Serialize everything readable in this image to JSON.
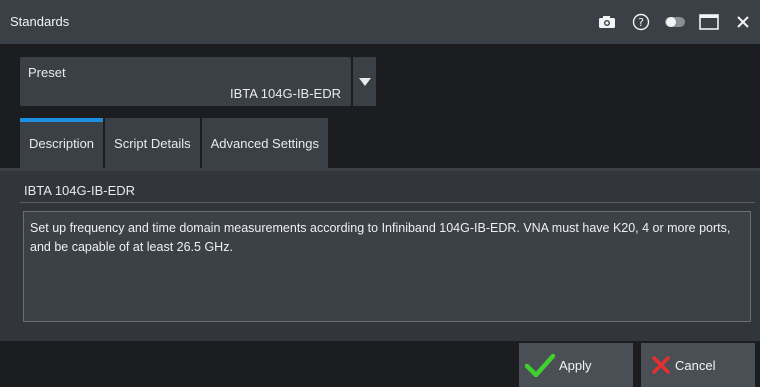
{
  "window": {
    "title": "Standards",
    "icons": [
      "camera-icon",
      "help-icon",
      "toggle-icon",
      "maximize-icon",
      "close-icon"
    ]
  },
  "preset": {
    "label": "Preset",
    "value": "IBTA 104G-IB-EDR"
  },
  "tabs": [
    {
      "label": "Description",
      "active": true
    },
    {
      "label": "Script Details",
      "active": false
    },
    {
      "label": "Advanced Settings",
      "active": false
    }
  ],
  "description": {
    "heading": "IBTA 104G-IB-EDR",
    "text": "Set up frequency and time domain measurements according to Infiniband 104G-IB-EDR. VNA must have K20, 4 or more ports, and be capable of at least 26.5 GHz."
  },
  "buttons": {
    "apply": "Apply",
    "cancel": "Cancel"
  },
  "colors": {
    "accent": "#1d8fe1",
    "apply_check": "#3fcf2f",
    "cancel_x": "#e53030"
  }
}
